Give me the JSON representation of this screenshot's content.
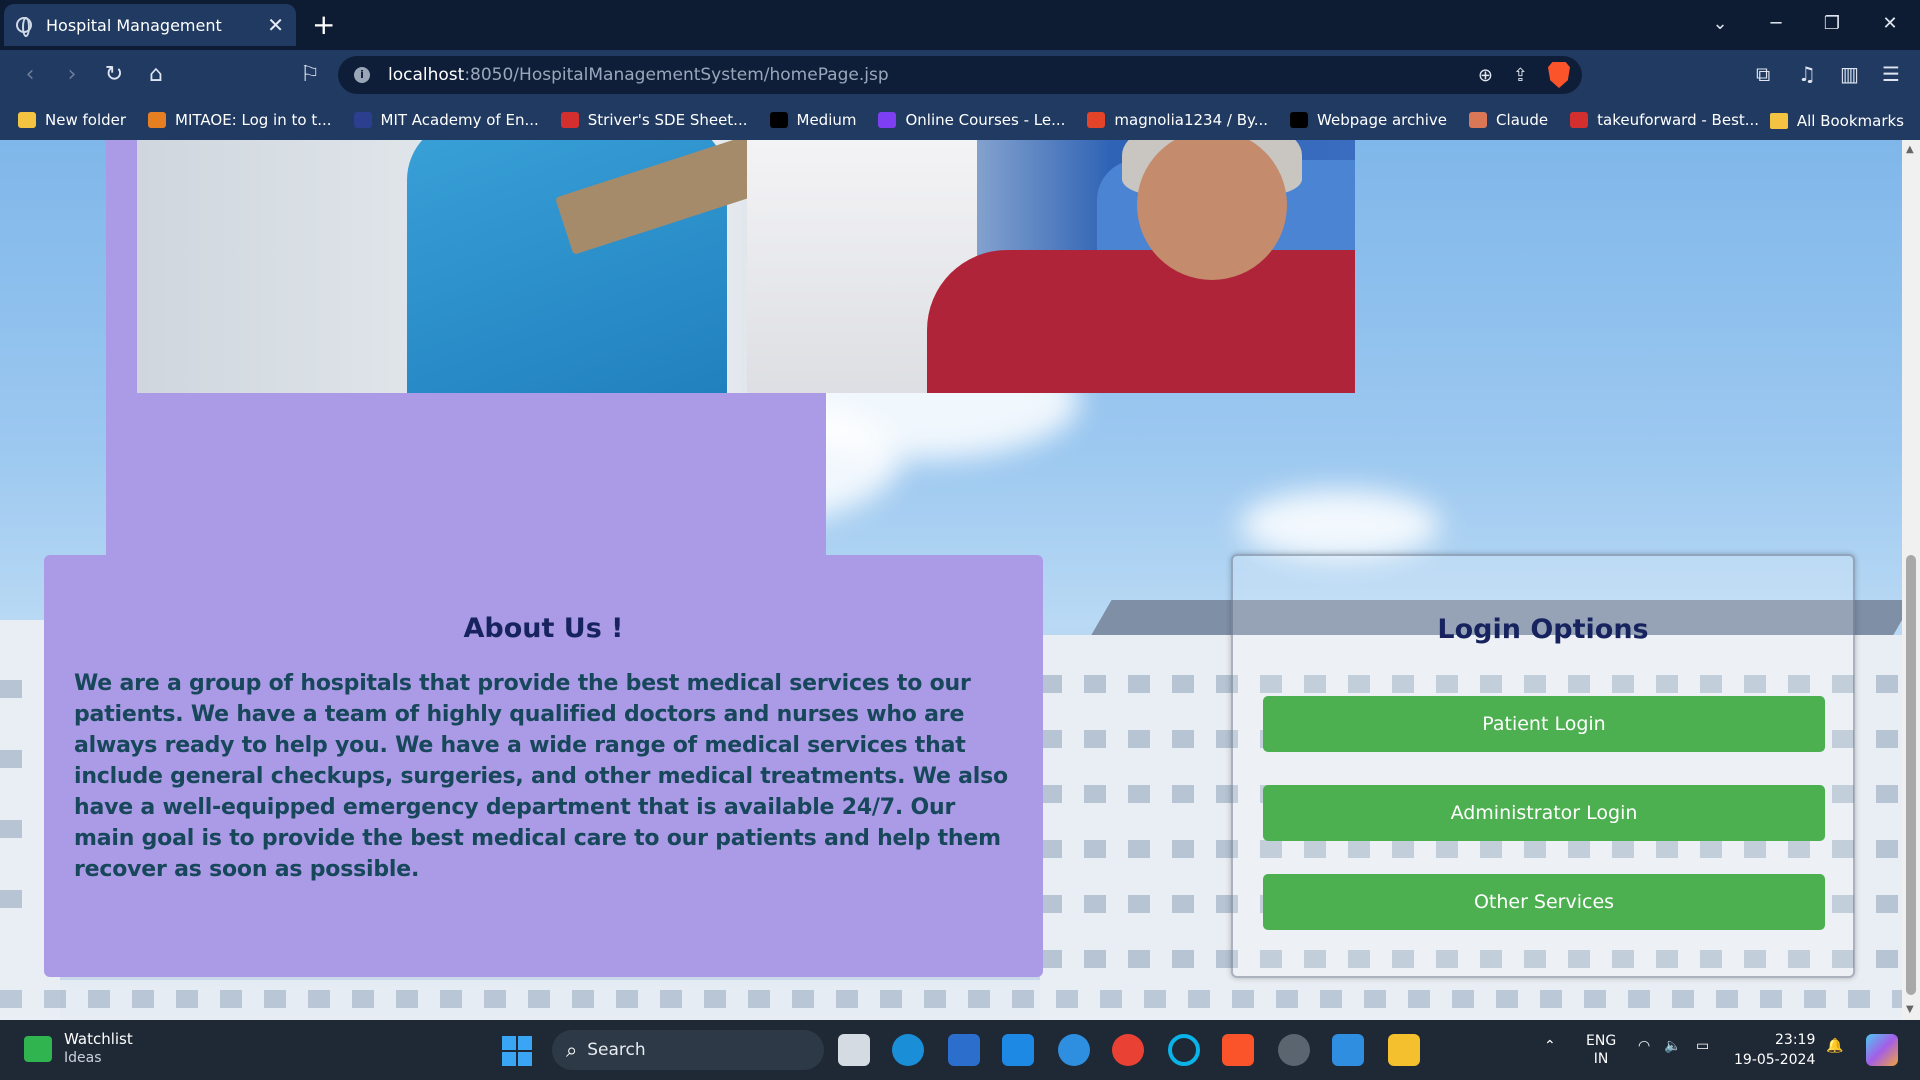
{
  "browser": {
    "tab_title": "Hospital Management",
    "tab_close": "✕",
    "new_tab": "+",
    "url_host": "localhost",
    "url_path": ":8050/HospitalManagementSystem/homePage.jsp",
    "bookmarks": [
      {
        "label": "New folder",
        "color": "#f5c342"
      },
      {
        "label": "MITAOE: Log in to t...",
        "color": "#e67e22"
      },
      {
        "label": "MIT Academy of En...",
        "color": "#2b3f8f"
      },
      {
        "label": "Striver's SDE Sheet...",
        "color": "#d32f2f"
      },
      {
        "label": "Medium",
        "color": "#000000"
      },
      {
        "label": "Online Courses - Le...",
        "color": "#7e3ff2"
      },
      {
        "label": "magnolia1234 / By...",
        "color": "#e24329"
      },
      {
        "label": "Webpage archive",
        "color": "#000000"
      },
      {
        "label": "Claude",
        "color": "#d97757"
      },
      {
        "label": "takeuforward - Best...",
        "color": "#d32f2f"
      }
    ],
    "all_bookmarks": "All Bookmarks"
  },
  "about": {
    "title": "About Us !",
    "text": "We are a group of hospitals that provide the best medical services to our patients. We have a team of highly qualified doctors and nurses who are always ready to help you. We have a wide range of medical services that include general checkups, surgeries, and other medical treatments. We also have a well-equipped emergency department that is available 24/7. Our main goal is to provide the best medical care to our patients and help them recover as soon as possible."
  },
  "login": {
    "title": "Login Options",
    "buttons": [
      "Patient Login",
      "Administrator Login",
      "Other Services"
    ],
    "button_color": "#4caf50"
  },
  "taskbar": {
    "widget_title": "Watchlist",
    "widget_sub": "Ideas",
    "search_label": "Search",
    "lang_top": "ENG",
    "lang_bottom": "IN",
    "time": "23:19",
    "date": "19-05-2024"
  },
  "colors": {
    "card_purple": "#ab9ae6",
    "heading_navy": "#16235e"
  }
}
